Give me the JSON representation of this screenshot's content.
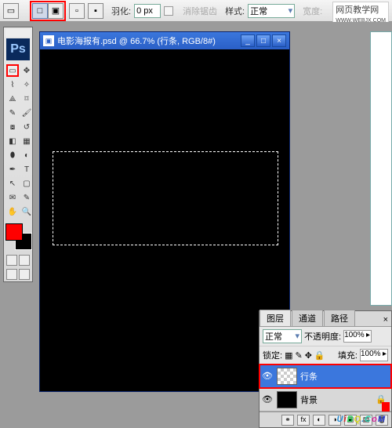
{
  "options": {
    "feather_label": "羽化:",
    "feather_value": "0 px",
    "antialias_label": "消除锯齿",
    "style_label": "样式:",
    "style_value": "正常",
    "width_label": "宽度:"
  },
  "watermark": {
    "line1": "网页教学网"
  },
  "ps_logo": "Ps",
  "doc": {
    "title": "电影海报有.psd @ 66.7% (行条, RGB/8#)"
  },
  "layers_panel": {
    "tabs": {
      "layers": "图层",
      "channels": "通道",
      "paths": "路径"
    },
    "blend_mode": "正常",
    "opacity_label": "不透明度:",
    "opacity_value": "100%",
    "lock_label": "锁定:",
    "fill_label": "填充:",
    "fill_value": "100%",
    "layers": [
      {
        "name": "行条",
        "selected": true,
        "transparent": true
      },
      {
        "name": "背景",
        "selected": false,
        "transparent": false
      }
    ]
  },
  "uibq": {
    "u": "U",
    "i": "i",
    "b": "B",
    "q": "Q",
    "d": ".",
    "c": "C",
    "o": "o",
    "m": "M"
  }
}
